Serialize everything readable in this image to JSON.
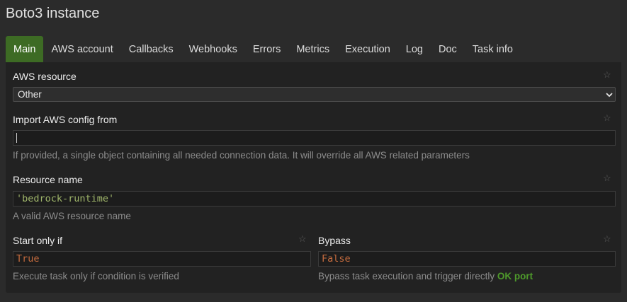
{
  "title": "Boto3 instance",
  "tabs": [
    "Main",
    "AWS account",
    "Callbacks",
    "Webhooks",
    "Errors",
    "Metrics",
    "Execution",
    "Log",
    "Doc",
    "Task info"
  ],
  "fields": {
    "aws_resource": {
      "label": "AWS resource",
      "selected": "Other"
    },
    "import_config": {
      "label": "Import AWS config from",
      "value": "",
      "help": "If provided, a single object containing all needed connection data. It will override all AWS related parameters"
    },
    "resource_name": {
      "label": "Resource name",
      "value": "'bedrock-runtime'",
      "help": "A valid AWS resource name"
    },
    "start_only_if": {
      "label": "Start only if",
      "value": "True",
      "help": "Execute task only if condition is verified"
    },
    "bypass": {
      "label": "Bypass",
      "value": "False",
      "help_prefix": "Bypass task execution and trigger directly",
      "help_link": "OK port"
    }
  },
  "colors": {
    "accent": "#3d6b24",
    "ok": "#4e9a2b",
    "string": "#9fb56a",
    "bool": "#c46b3e"
  },
  "icons": {
    "favorite": "star-outline-icon",
    "select_arrow": "chevron-down-icon"
  }
}
